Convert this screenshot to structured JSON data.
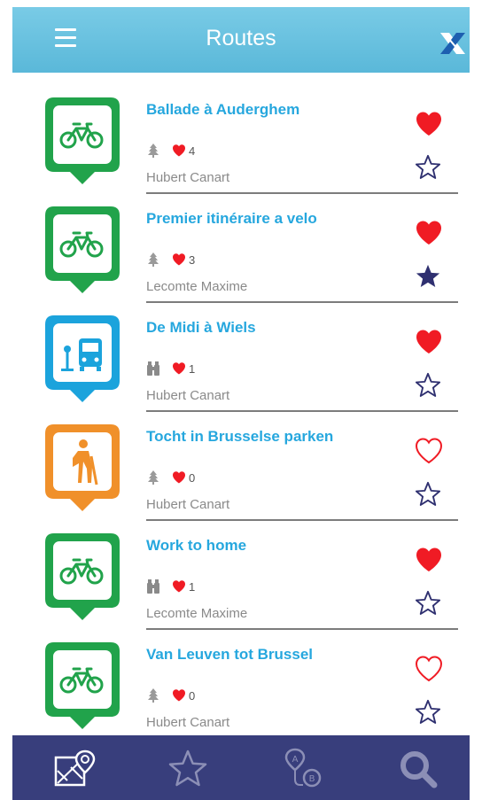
{
  "header": {
    "title": "Routes",
    "menu_icon": "hamburger-menu-icon",
    "close_icon": "close-x-icon"
  },
  "colors": {
    "header": "#5ab8d9",
    "title_text": "#26a7de",
    "heart": "#f01b24",
    "star": "#2f3070",
    "tabbar": "#383e7c",
    "bike": "#21a34b",
    "bus": "#1ba3dc",
    "hike": "#f0902a"
  },
  "routes": [
    {
      "title": "Ballade à Auderghem",
      "mode": "bike",
      "mode_icon": "bicycle-icon",
      "terrain_icon": "tree-icon",
      "likes": "4",
      "author": "Hubert Canart",
      "liked": true,
      "starred": false
    },
    {
      "title": "Premier itinéraire a velo",
      "mode": "bike",
      "mode_icon": "bicycle-icon",
      "terrain_icon": "tree-icon",
      "likes": "3",
      "author": "Lecomte Maxime",
      "liked": true,
      "starred": true
    },
    {
      "title": "De Midi à Wiels",
      "mode": "bus",
      "mode_icon": "bus-icon",
      "terrain_icon": "binoculars-icon",
      "likes": "1",
      "author": "Hubert Canart",
      "liked": true,
      "starred": false
    },
    {
      "title": "Tocht in Brusselse parken",
      "mode": "hike",
      "mode_icon": "hiker-icon",
      "terrain_icon": "tree-icon",
      "likes": "0",
      "author": "Hubert Canart",
      "liked": false,
      "starred": false
    },
    {
      "title": "Work to home",
      "mode": "bike",
      "mode_icon": "bicycle-icon",
      "terrain_icon": "binoculars-icon",
      "likes": "1",
      "author": "Lecomte Maxime",
      "liked": true,
      "starred": false
    },
    {
      "title": "Van Leuven tot Brussel",
      "mode": "bike",
      "mode_icon": "bicycle-icon",
      "terrain_icon": "tree-icon",
      "likes": "0",
      "author": "Hubert Canart",
      "liked": false,
      "starred": false
    }
  ],
  "tabbar": {
    "items": [
      {
        "icon": "map-icon",
        "active": true
      },
      {
        "icon": "star-icon",
        "active": false
      },
      {
        "icon": "route-a-b-icon",
        "active": false
      },
      {
        "icon": "search-icon",
        "active": false
      }
    ]
  }
}
